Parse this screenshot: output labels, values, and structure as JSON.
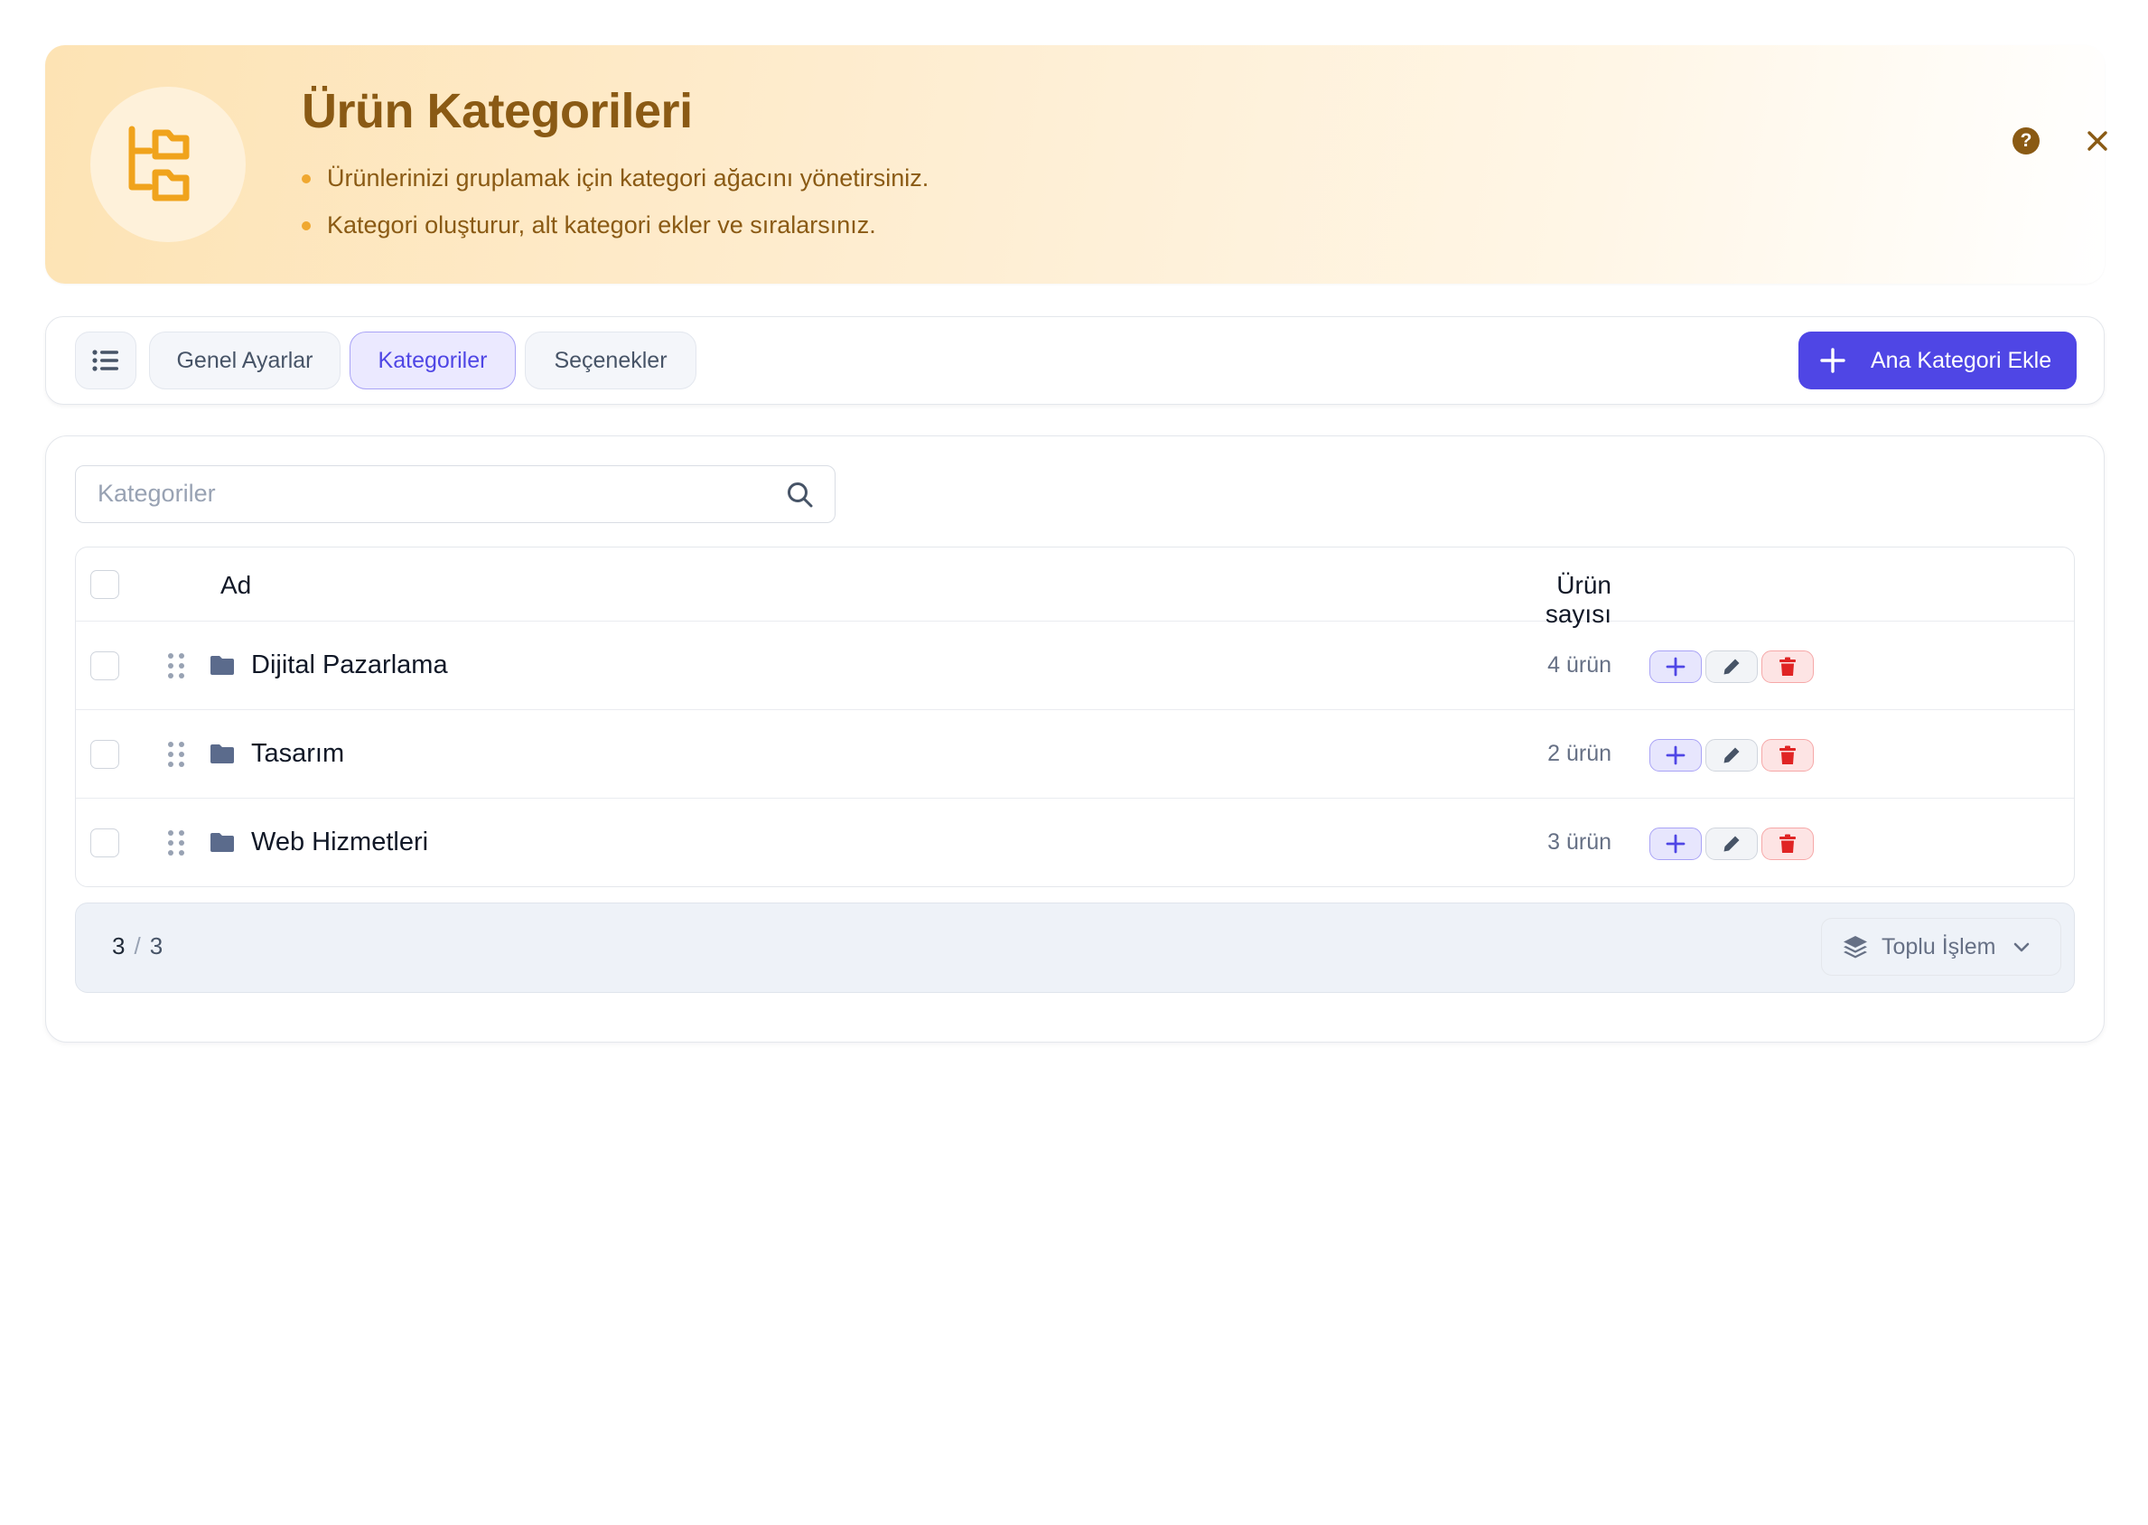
{
  "header": {
    "title": "Ürün Kategorileri",
    "bullets": [
      "Ürünlerinizi gruplamak için kategori ağacını yönetirsiniz.",
      "Kategori oluşturur, alt kategori ekler ve sıralarsınız."
    ],
    "help_glyph": "?",
    "logo_icon": "folder-tree-icon",
    "help_icon": "question-circle-icon",
    "close_icon": "close-icon"
  },
  "toolbar": {
    "menu_icon": "list-icon",
    "tabs": [
      {
        "label": "Genel Ayarlar",
        "active": false
      },
      {
        "label": "Kategoriler",
        "active": true
      },
      {
        "label": "Seçenekler",
        "active": false
      }
    ],
    "add_button_label": "Ana Kategori Ekle",
    "add_button_icon": "plus-icon"
  },
  "search": {
    "placeholder": "Kategoriler",
    "value": "",
    "icon": "search-icon"
  },
  "table": {
    "columns": {
      "name": "Ad",
      "count": "Ürün sayısı"
    },
    "rows": [
      {
        "name": "Dijital Pazarlama",
        "count": "4 ürün"
      },
      {
        "name": "Tasarım",
        "count": "2 ürün"
      },
      {
        "name": "Web Hizmetleri",
        "count": "3 ürün"
      }
    ],
    "row_icons": [
      "drag-handle-icon",
      "folder-icon",
      "plus-icon",
      "pencil-icon",
      "trash-icon"
    ]
  },
  "footer": {
    "shown": "3",
    "separator": "/",
    "total": "3",
    "bulk_label": "Toplu İşlem",
    "bulk_icons": [
      "layers-icon",
      "chevron-down-icon"
    ]
  },
  "colors": {
    "accent": "#4f46e5",
    "banner_text": "#8a5a14",
    "banner_icon": "#f0a31c",
    "danger": "#e02424",
    "folder": "#5b6b8c"
  }
}
